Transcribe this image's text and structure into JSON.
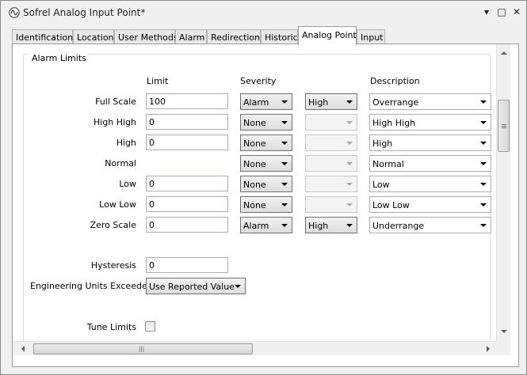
{
  "window": {
    "title": "Sofrel Analog Input Point*",
    "controls": {
      "pin": "▾",
      "close_icon": "✕",
      "maximize_icon": "□"
    }
  },
  "tabs": [
    {
      "label": "Identification",
      "active": false
    },
    {
      "label": "Location",
      "active": false
    },
    {
      "label": "User Methods",
      "active": false
    },
    {
      "label": "Alarm",
      "active": false
    },
    {
      "label": "Redirection",
      "active": false
    },
    {
      "label": "Historic",
      "active": false
    },
    {
      "label": "Analog Point",
      "active": true
    },
    {
      "label": "Input",
      "active": false
    }
  ],
  "alarm_limits": {
    "group_title": "Alarm Limits",
    "headers": {
      "limit": "Limit",
      "severity": "Severity",
      "description": "Description"
    },
    "rows": [
      {
        "label": "Full Scale",
        "limit": "100",
        "severity": "Alarm",
        "level": "High",
        "level_enabled": true,
        "description": "Overrange"
      },
      {
        "label": "High High",
        "limit": "0",
        "severity": "None",
        "level": "",
        "level_enabled": false,
        "description": "High High"
      },
      {
        "label": "High",
        "limit": "0",
        "severity": "None",
        "level": "",
        "level_enabled": false,
        "description": "High"
      },
      {
        "label": "Normal",
        "limit": "",
        "severity": "None",
        "level": "",
        "level_enabled": false,
        "description": "Normal"
      },
      {
        "label": "Low",
        "limit": "0",
        "severity": "None",
        "level": "",
        "level_enabled": false,
        "description": "Low"
      },
      {
        "label": "Low Low",
        "limit": "0",
        "severity": "None",
        "level": "",
        "level_enabled": false,
        "description": "Low Low"
      },
      {
        "label": "Zero Scale",
        "limit": "0",
        "severity": "Alarm",
        "level": "High",
        "level_enabled": true,
        "description": "Underrange"
      }
    ],
    "hysteresis": {
      "label": "Hysteresis",
      "value": "0"
    },
    "eng_units": {
      "label": "Engineering Units Exceeded",
      "value": "Use Reported Value"
    },
    "tune_limits": {
      "label": "Tune Limits",
      "checked": false
    }
  },
  "scrollbars": {
    "h_grip": "|||"
  }
}
